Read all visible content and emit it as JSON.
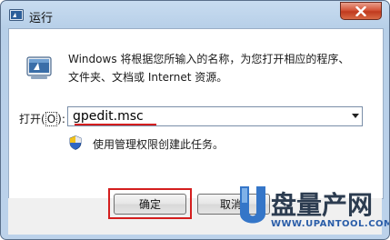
{
  "window": {
    "title": "运行",
    "title_icon": "run-icon",
    "close_icon": "close-icon"
  },
  "content": {
    "description": "Windows 将根据您所输入的名称，为您打开相应的程序、文件夹、文档或 Internet 资源。",
    "open_label_prefix": "打开(",
    "open_label_hotkey": "O",
    "open_label_suffix": "):",
    "command_value": "gpedit.msc",
    "admin_note": "使用管理权限创建此任务。"
  },
  "buttons": {
    "ok": "确定",
    "cancel": "取消"
  },
  "watermark": {
    "name": "盘量产网",
    "url": "WWW.UPANTOOL.COM"
  },
  "colors": {
    "highlight": "#d41e1e",
    "title_gradient_top": "#c8dcf0",
    "close_button": "#c03a1e"
  }
}
